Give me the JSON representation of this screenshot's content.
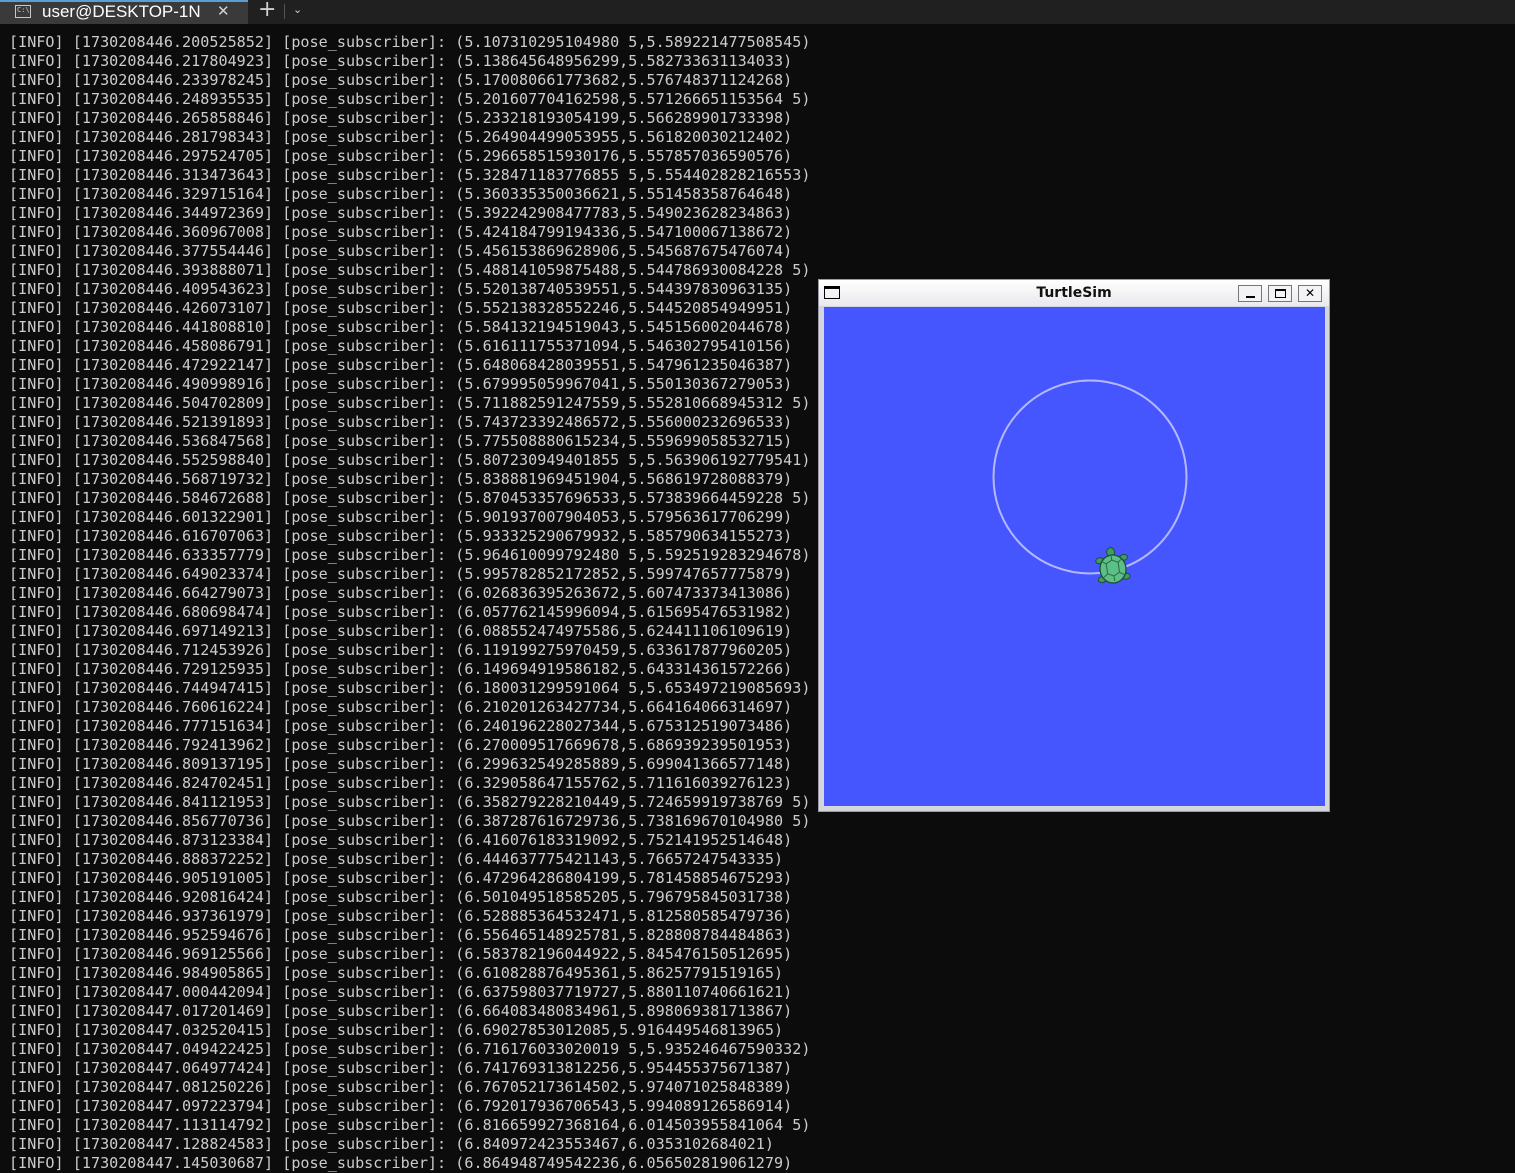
{
  "terminal_tab": {
    "title": "user@DESKTOP-1N",
    "close_glyph": "✕",
    "new_tab_glyph": "+",
    "dropdown_glyph": "⌄",
    "icon": "terminal-icon"
  },
  "turtlesim": {
    "title": "TurtleSim",
    "close_glyph": "✕",
    "background_color": "#4556ff",
    "trail_color": "#b3b8ff"
  },
  "log": [
    "[INFO] [1730208446.200525852] [pose_subscriber]: (5.107310295104980 5,5.589221477508545)",
    "[INFO] [1730208446.217804923] [pose_subscriber]: (5.138645648956299,5.582733631134033)",
    "[INFO] [1730208446.233978245] [pose_subscriber]: (5.170080661773682,5.576748371124268)",
    "[INFO] [1730208446.248935535] [pose_subscriber]: (5.201607704162598,5.571266651153564 5)",
    "[INFO] [1730208446.265858846] [pose_subscriber]: (5.233218193054199,5.566289901733398)",
    "[INFO] [1730208446.281798343] [pose_subscriber]: (5.264904499053955,5.561820030212402)",
    "[INFO] [1730208446.297524705] [pose_subscriber]: (5.296658515930176,5.557857036590576)",
    "[INFO] [1730208446.313473643] [pose_subscriber]: (5.328471183776855 5,5.554402828216553)",
    "[INFO] [1730208446.329715164] [pose_subscriber]: (5.360335350036621,5.551458358764648)",
    "[INFO] [1730208446.344972369] [pose_subscriber]: (5.392242908477783,5.549023628234863)",
    "[INFO] [1730208446.360967008] [pose_subscriber]: (5.424184799194336,5.547100067138672)",
    "[INFO] [1730208446.377554446] [pose_subscriber]: (5.456153869628906,5.545687675476074)",
    "[INFO] [1730208446.393888071] [pose_subscriber]: (5.488141059875488,5.544786930084228 5)",
    "[INFO] [1730208446.409543623] [pose_subscriber]: (5.520138740539551,5.544397830963135)",
    "[INFO] [1730208446.426073107] [pose_subscriber]: (5.552138328552246,5.544520854949951)",
    "[INFO] [1730208446.441808810] [pose_subscriber]: (5.584132194519043,5.545156002044678)",
    "[INFO] [1730208446.458086791] [pose_subscriber]: (5.616111755371094,5.546302795410156)",
    "[INFO] [1730208446.472922147] [pose_subscriber]: (5.648068428039551,5.547961235046387)",
    "[INFO] [1730208446.490998916] [pose_subscriber]: (5.679995059967041,5.550130367279053)",
    "[INFO] [1730208446.504702809] [pose_subscriber]: (5.711882591247559,5.552810668945312 5)",
    "[INFO] [1730208446.521391893] [pose_subscriber]: (5.743723392486572,5.556000232696533)",
    "[INFO] [1730208446.536847568] [pose_subscriber]: (5.775508880615234,5.559699058532715)",
    "[INFO] [1730208446.552598840] [pose_subscriber]: (5.807230949401855 5,5.563906192779541)",
    "[INFO] [1730208446.568719732] [pose_subscriber]: (5.838881969451904,5.568619728088379)",
    "[INFO] [1730208446.584672688] [pose_subscriber]: (5.870453357696533,5.573839664459228 5)",
    "[INFO] [1730208446.601322901] [pose_subscriber]: (5.901937007904053,5.579563617706299)",
    "[INFO] [1730208446.616707063] [pose_subscriber]: (5.933325290679932,5.585790634155273)",
    "[INFO] [1730208446.633357779] [pose_subscriber]: (5.964610099792480 5,5.592519283294678)",
    "[INFO] [1730208446.649023374] [pose_subscriber]: (5.995782852172852,5.599747657775879)",
    "[INFO] [1730208446.664279073] [pose_subscriber]: (6.026836395263672,5.607473373413086)",
    "[INFO] [1730208446.680698474] [pose_subscriber]: (6.057762145996094,5.615695476531982)",
    "[INFO] [1730208446.697149213] [pose_subscriber]: (6.088552474975586,5.624411106109619)",
    "[INFO] [1730208446.712453926] [pose_subscriber]: (6.119199275970459,5.633617877960205)",
    "[INFO] [1730208446.729125935] [pose_subscriber]: (6.149694919586182,5.643314361572266)",
    "[INFO] [1730208446.744947415] [pose_subscriber]: (6.180031299591064 5,5.653497219085693)",
    "[INFO] [1730208446.760616224] [pose_subscriber]: (6.210201263427734,5.664164066314697)",
    "[INFO] [1730208446.777151634] [pose_subscriber]: (6.240196228027344,5.675312519073486)",
    "[INFO] [1730208446.792413962] [pose_subscriber]: (6.270009517669678,5.686939239501953)",
    "[INFO] [1730208446.809137195] [pose_subscriber]: (6.299632549285889,5.699041366577148)",
    "[INFO] [1730208446.824702451] [pose_subscriber]: (6.329058647155762,5.711616039276123)",
    "[INFO] [1730208446.841121953] [pose_subscriber]: (6.358279228210449,5.724659919738769 5)",
    "[INFO] [1730208446.856770736] [pose_subscriber]: (6.387287616729736,5.738169670104980 5)",
    "[INFO] [1730208446.873123384] [pose_subscriber]: (6.416076183319092,5.752141952514648)",
    "[INFO] [1730208446.888372252] [pose_subscriber]: (6.444637775421143,5.76657247543335)",
    "[INFO] [1730208446.905191005] [pose_subscriber]: (6.472964286804199,5.781458854675293)",
    "[INFO] [1730208446.920816424] [pose_subscriber]: (6.501049518585205,5.796795845031738)",
    "[INFO] [1730208446.937361979] [pose_subscriber]: (6.528885364532471,5.812580585479736)",
    "[INFO] [1730208446.952594676] [pose_subscriber]: (6.556465148925781,5.828808784484863)",
    "[INFO] [1730208446.969125566] [pose_subscriber]: (6.583782196044922,5.845476150512695)",
    "[INFO] [1730208446.984905865] [pose_subscriber]: (6.610828876495361,5.86257791519165)",
    "[INFO] [1730208447.000442094] [pose_subscriber]: (6.637598037719727,5.880110740661621)",
    "[INFO] [1730208447.017201469] [pose_subscriber]: (6.664083480834961,5.898069381713867)",
    "[INFO] [1730208447.032520415] [pose_subscriber]: (6.69027853012085,5.916449546813965)",
    "[INFO] [1730208447.049422425] [pose_subscriber]: (6.716176033020019 5,5.935246467590332)",
    "[INFO] [1730208447.064977424] [pose_subscriber]: (6.741769313812256,5.954455375671387)",
    "[INFO] [1730208447.081250226] [pose_subscriber]: (6.767052173614502,5.974071025848389)",
    "[INFO] [1730208447.097223794] [pose_subscriber]: (6.792017936706543,5.994089126586914)",
    "[INFO] [1730208447.113114792] [pose_subscriber]: (6.816659927368164,6.014503955841064 5)",
    "[INFO] [1730208447.128824583] [pose_subscriber]: (6.840972423553467,6.0353102684021)",
    "[INFO] [1730208447.145030687] [pose_subscriber]: (6.864948749542236,6.056502819061279)"
  ]
}
